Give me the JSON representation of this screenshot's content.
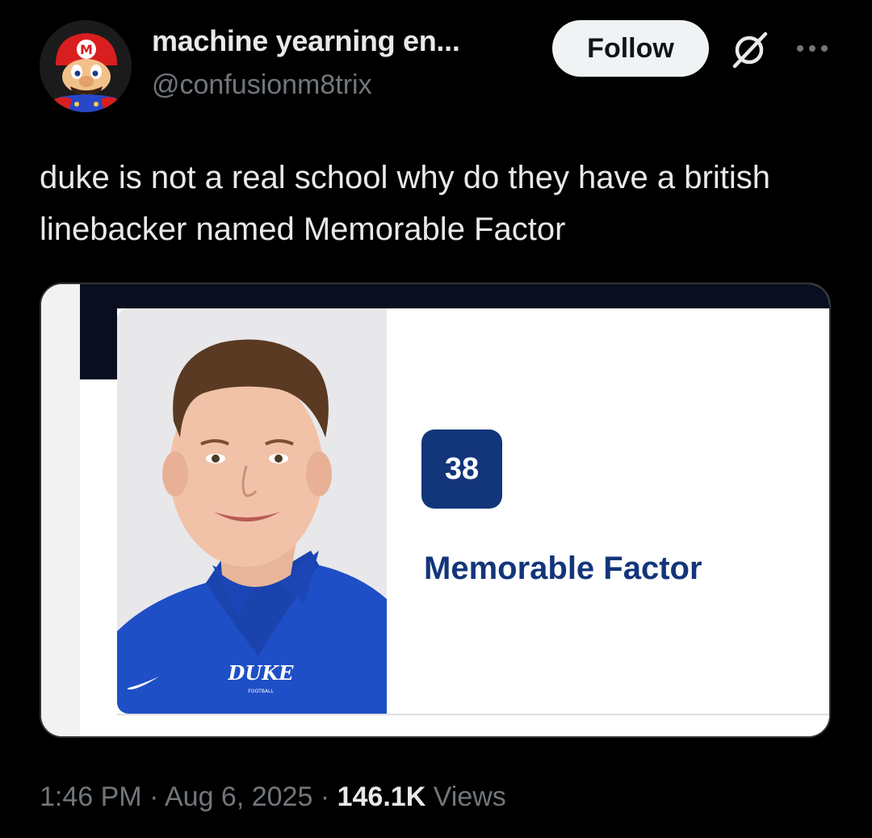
{
  "author": {
    "display_name": "machine yearning en...",
    "handle": "@confusionm8trix",
    "avatar_icon": "mario-avatar-icon"
  },
  "actions": {
    "follow_label": "Follow",
    "grok_icon": "grok-icon",
    "more_icon": "more-options-icon"
  },
  "tweet": {
    "text": "duke is not a real school why do they have a british linebacker named Memorable Factor"
  },
  "media": {
    "jersey_number": "38",
    "player_name": "Memorable Factor",
    "shirt_logo_text": "DUKE",
    "shirt_logo_subtext": "FOOTBALL",
    "accent_color": "#13357a"
  },
  "meta": {
    "time": "1:46 PM",
    "separator": "·",
    "date": "Aug 6, 2025",
    "views_count": "146.1K",
    "views_label": "Views"
  }
}
